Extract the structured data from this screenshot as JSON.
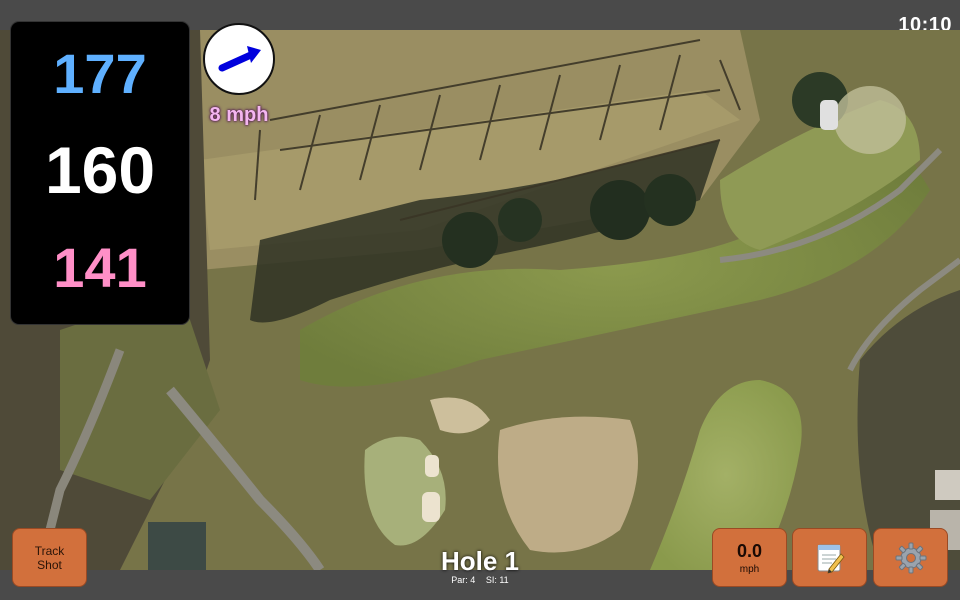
{
  "status": {
    "time": "10:10"
  },
  "distances": {
    "back": "177",
    "center": "160",
    "front": "141"
  },
  "wind": {
    "speed_label": "8 mph",
    "direction": "east-northeast",
    "icon": "arrow-icon"
  },
  "hole": {
    "title": "Hole 1",
    "par": "Par: 4",
    "stroke_index": "SI: 11"
  },
  "buttons": {
    "track_shot": "Track\nShot",
    "wind_value": "0.0",
    "wind_unit": "mph",
    "notes_icon": "notepad-icon",
    "settings_icon": "gear-icon"
  },
  "colors": {
    "back_distance": "#5fb0ff",
    "center_distance": "#ffffff",
    "front_distance": "#ff8fc7",
    "button": "#d2703c",
    "wind_arrow": "#0000dd"
  }
}
